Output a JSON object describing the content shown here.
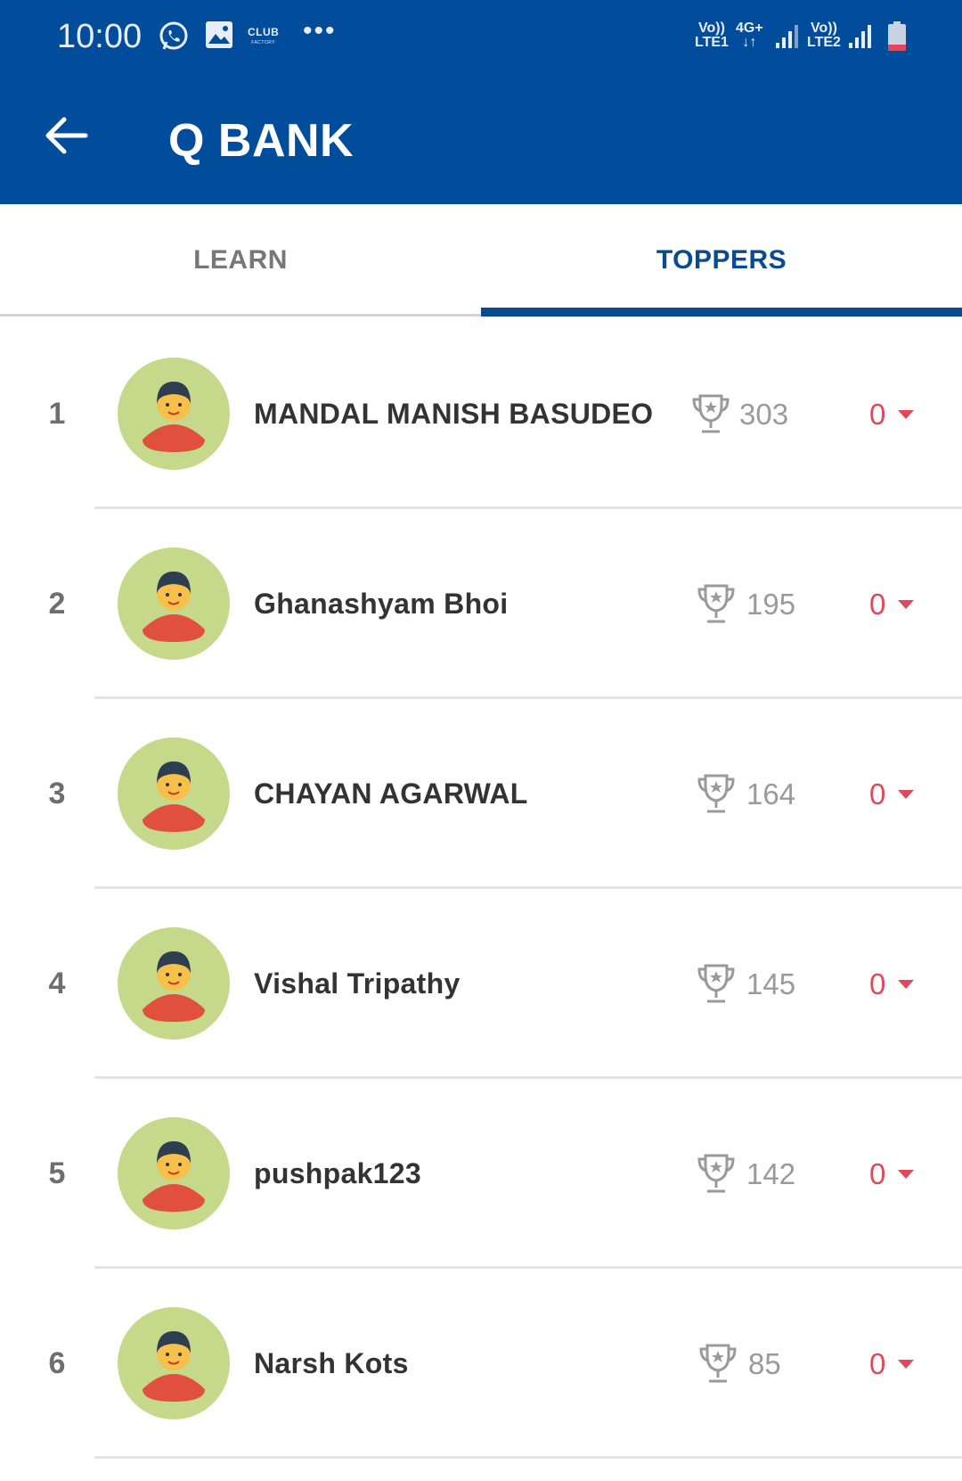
{
  "status_bar": {
    "time": "10:00",
    "club_text": "CLUB",
    "club_sub": "FACTORY",
    "more": "•••",
    "sim1_top": "Vo))",
    "sim1_bottom": "LTE1",
    "net_type": "4G+",
    "net_arrows": "↓↑",
    "sim2_top": "Vo))",
    "sim2_bottom": "LTE2"
  },
  "toolbar": {
    "title": "Q BANK",
    "back_icon": "arrow-left-icon"
  },
  "tabs": [
    {
      "label": "LEARN",
      "selected": false
    },
    {
      "label": "TOPPERS",
      "selected": true
    }
  ],
  "colors": {
    "app_bar": "#014c9b",
    "tab_selected": "#0a4b8f",
    "delta_red": "#e0485c",
    "avatar_bg": "#c6d98a"
  },
  "toppers": [
    {
      "rank": "1",
      "name": "MANDAL MANISH BASUDEO",
      "score": "303",
      "change": "0"
    },
    {
      "rank": "2",
      "name": "Ghanashyam Bhoi",
      "score": "195",
      "change": "0"
    },
    {
      "rank": "3",
      "name": "CHAYAN AGARWAL",
      "score": "164",
      "change": "0"
    },
    {
      "rank": "4",
      "name": "Vishal Tripathy",
      "score": "145",
      "change": "0"
    },
    {
      "rank": "5",
      "name": "pushpak123",
      "score": "142",
      "change": "0"
    },
    {
      "rank": "6",
      "name": "Narsh Kots",
      "score": "85",
      "change": "0"
    }
  ]
}
